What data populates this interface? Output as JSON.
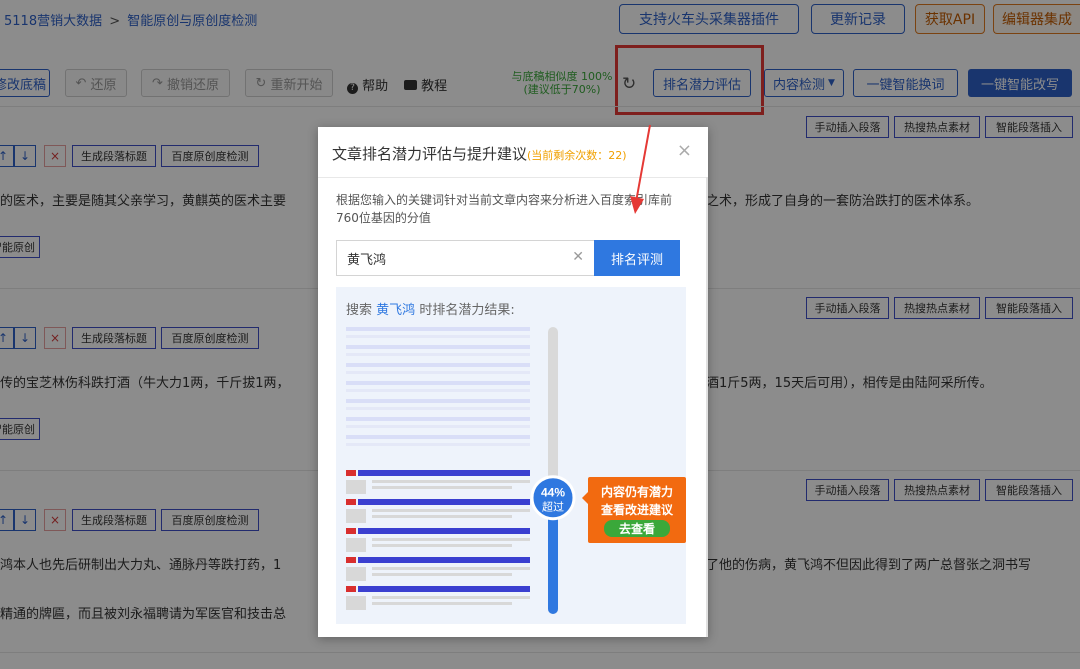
{
  "breadcrumb": {
    "root": "5118营销大数据",
    "sep": ">",
    "current": "智能原创与原创度检测"
  },
  "top_buttons": {
    "plugin": "支持火车头采集器插件",
    "changelog": "更新记录",
    "api": "获取API",
    "editor": "编辑器集成"
  },
  "toolbar": {
    "modify_draft": "修改底稿",
    "restore": "还原",
    "undo_restore": "撤销还原",
    "restart": "重新开始",
    "help": "帮助",
    "tutorial": "教程",
    "similarity_line1": "与底稿相似度 100%",
    "similarity_line2": "(建议低于70%)",
    "rank_eval": "排名潜力评估",
    "content_check": "内容检测",
    "one_click_replace": "一键智能换词",
    "one_click_rewrite": "一键智能改写"
  },
  "para_actions": {
    "manual_insert": "手动插入段落",
    "hot_material": "热搜热点素材",
    "smart_insert": "智能段落插入",
    "gen_title": "生成段落标题",
    "baidu_check": "百度原创度检测",
    "smart_original": "智能原创"
  },
  "paragraphs": {
    "p1_left": "的医术，主要是随其父亲学习，黄麒英的医术主要",
    "p1_right": "之术，形成了自身的一套防治跌打的医术体系。",
    "p2_left": "传的宝芝林伤科跌打酒（牛大力1两，千斤拔1两，",
    "p2_right": "酒1斤5两，15天后可用），相传是由陆阿采所传。",
    "p3_left": "鸿本人也先后研制出大力丸、通脉丹等跌打药，1",
    "p3_right": "了他的伤病，黄飞鸿不但因此得到了两广总督张之洞书写",
    "p4_left": "精通的牌匾，而且被刘永福聘请为军医官和技击总"
  },
  "modal": {
    "title": "文章排名潜力评估与提升建议",
    "remaining": "(当前剩余次数：22)",
    "close": "×",
    "description": "根据您输入的关键词针对当前文章内容来分析进入百度索引库前760位基因的分值",
    "keyword": "黄飞鸿",
    "submit": "排名评测",
    "result_prefix": "搜索",
    "result_suffix": "时排名潜力结果:",
    "gauge_value": 44,
    "gauge_percent": "44%",
    "gauge_label": "超过",
    "cta_line1": "内容仍有潜力",
    "cta_line2": "查看改进建议",
    "cta_button": "去查看"
  },
  "colors": {
    "accent": "#2f62c9",
    "highlight_box": "#e53935",
    "orange": "#f26a10",
    "green": "#3aa83a"
  }
}
